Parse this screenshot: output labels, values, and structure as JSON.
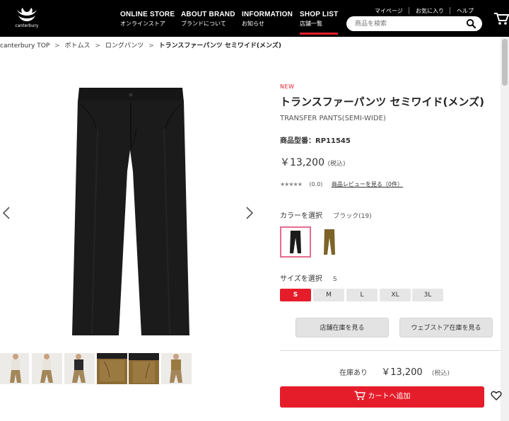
{
  "header": {
    "logo_text": "canterbury",
    "nav": [
      {
        "en": "ONLINE STORE",
        "jp": "オンラインストア"
      },
      {
        "en": "ABOUT BRAND",
        "jp": "ブランドについて"
      },
      {
        "en": "INFORMATION",
        "jp": "お知らせ"
      },
      {
        "en": "SHOP LIST",
        "jp": "店舗一覧"
      }
    ],
    "util": [
      "マイページ",
      "お気に入り",
      "ヘルプ"
    ],
    "search_placeholder": "商品を検索"
  },
  "breadcrumb": [
    "canterbury TOP",
    "ボトムス",
    "ロングパンツ",
    "トランスファーパンツ セミワイド(メンズ)"
  ],
  "breadcrumb_sep": ">",
  "product": {
    "badge": "NEW",
    "title": "トランスファーパンツ セミワイド(メンズ)",
    "subtitle": "TRANSFER PANTS(SEMI-WIDE)",
    "model": "商品型番：RP11545",
    "price": "￥13,200",
    "price_tax": "(税込)",
    "rating_stars": "★★★★★",
    "rating_value": "(0.0)",
    "review_link": "商品レビューを見る（0件）",
    "rating_score": 0,
    "color_label": "カラーを選択",
    "color_value": "ブラック(19)",
    "size_label": "サイズを選択",
    "size_value": "S",
    "sizes": [
      "S",
      "M",
      "L",
      "XL",
      "3L"
    ],
    "selected_size": "S",
    "store_stock_btn": "店舗在庫を見る",
    "web_stock_btn": "ウェブストア在庫を見る",
    "stock_status": "在庫あり",
    "stock_price": "￥13,200",
    "stock_tax": "(税込)",
    "add_to_cart": "カートへ追加"
  },
  "colors": {
    "accent": "#e51d2a",
    "swatch_selected_border": "#e86b8f",
    "black_pants": "#1b1b1b",
    "brown_pants": "#7c6428"
  }
}
